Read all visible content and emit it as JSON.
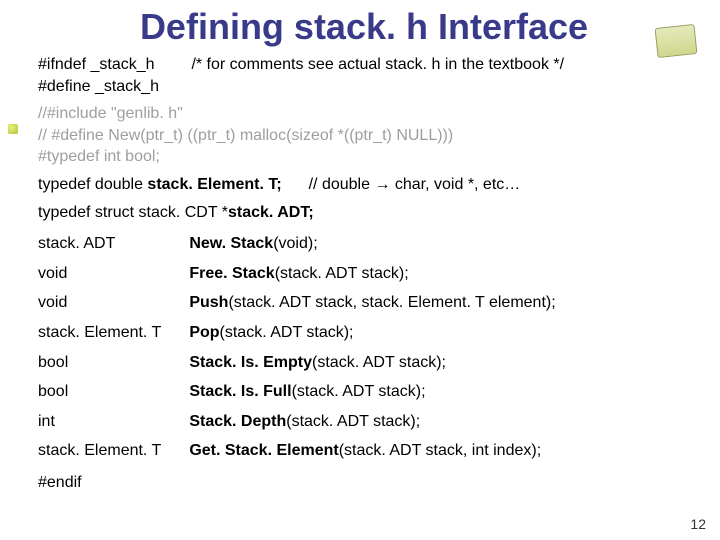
{
  "title": "Defining stack. h Interface",
  "guard": {
    "ifndef": "#ifndef _stack_h",
    "define": "#define _stack_h",
    "comment": "/* for comments see actual stack. h in the textbook */"
  },
  "commented": {
    "include": "//#include \"genlib. h\"",
    "defnew": "// #define New(ptr_t)   ((ptr_t) malloc(sizeof *((ptr_t) NULL)))",
    "typedefbool": "#typedef int bool;"
  },
  "typedef_elem": {
    "prefix": "typedef double ",
    "name": "stack. Element. T;",
    "comment": "// double → char, void *, etc…"
  },
  "typedef_adt": {
    "prefix": "typedef struct ",
    "mid": "stack. CDT *",
    "name": "stack. ADT;"
  },
  "functions": [
    {
      "ret": "stack. ADT",
      "fn": "New. Stack",
      "args": "(void);"
    },
    {
      "ret": "void",
      "fn": "Free. Stack",
      "args": "(stack. ADT stack);"
    },
    {
      "ret": "void",
      "fn": "Push",
      "args": "(stack. ADT stack, stack. Element. T element);"
    },
    {
      "ret": "stack. Element. T",
      "fn": "Pop",
      "args": "(stack. ADT stack);"
    },
    {
      "ret": "bool",
      "fn": "Stack. Is. Empty",
      "args": "(stack. ADT stack);"
    },
    {
      "ret": "bool",
      "fn": "Stack. Is. Full",
      "args": "(stack. ADT stack);"
    },
    {
      "ret": "int",
      "fn": "Stack. Depth",
      "args": "(stack. ADT stack);"
    },
    {
      "ret": "stack. Element. T",
      "fn": "Get. Stack. Element",
      "args": "(stack. ADT stack, int index);"
    }
  ],
  "endif": "#endif",
  "page_number": "12"
}
